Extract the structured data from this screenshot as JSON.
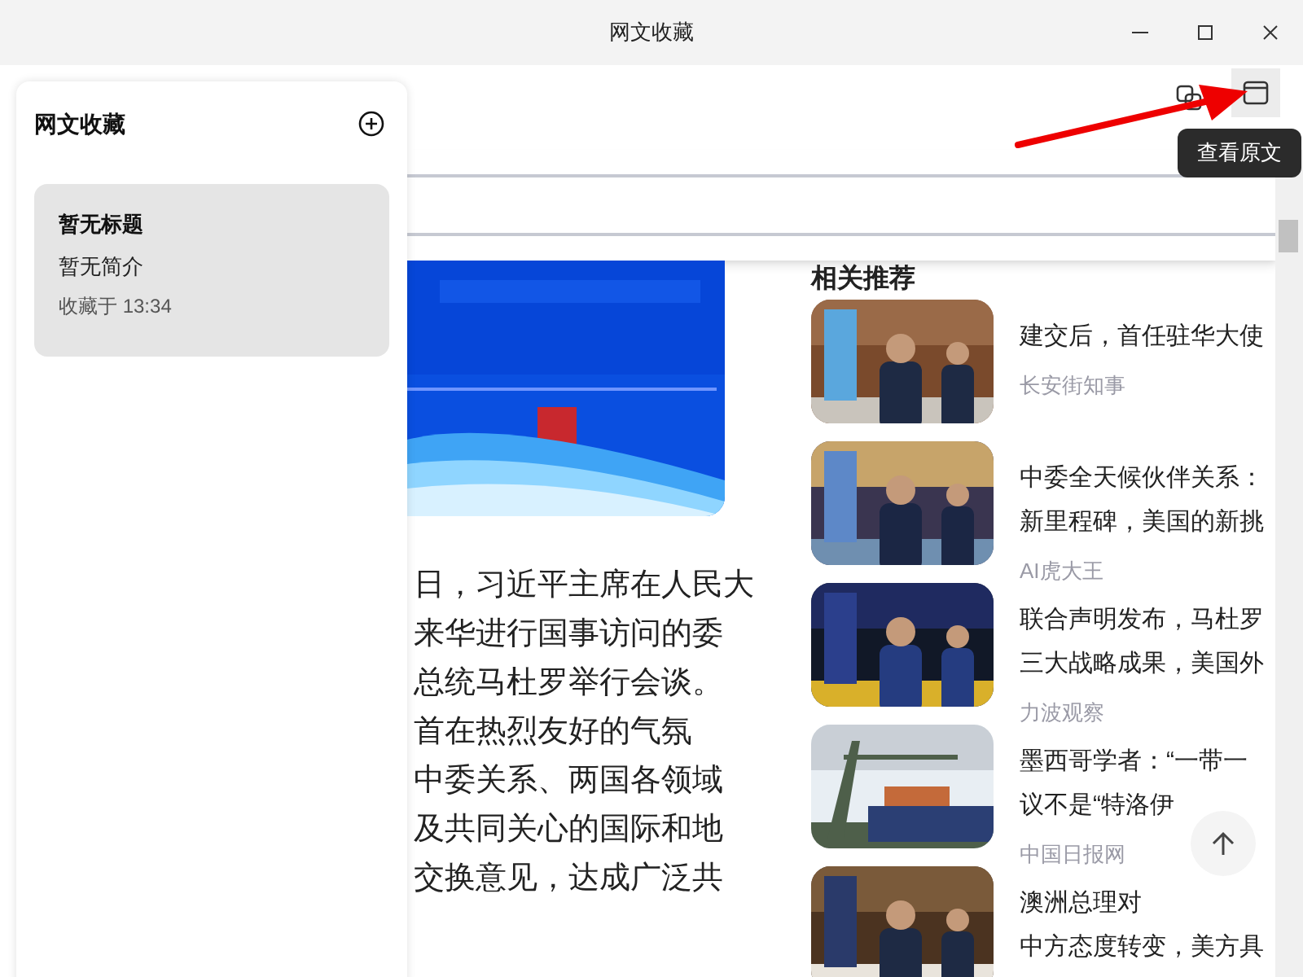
{
  "window": {
    "title": "网文收藏"
  },
  "toolbar": {
    "tooltip": "查看原文"
  },
  "sidebar": {
    "title": "网文收藏",
    "items": [
      {
        "title": "暂无标题",
        "summary": "暂无简介",
        "saved_at": "收藏于 13:34",
        "selected": true
      }
    ]
  },
  "article": {
    "lines": [
      "日，习近平主席在人民大",
      "来华进行国事访问的委",
      "总统马杜罗举行会谈。",
      "首在热烈友好的气氛",
      "中委关系、两国各领域",
      "及共同关心的国际和地",
      "交换意见，达成广泛共"
    ]
  },
  "related": {
    "title": "相关推荐",
    "items": [
      {
        "title_lines": [
          "建交后，首任驻华大使"
        ],
        "source": "长安街知事"
      },
      {
        "title_lines": [
          "中委全天候伙伴关系：",
          "新里程碑，美国的新挑"
        ],
        "source": "AI虎大王"
      },
      {
        "title_lines": [
          "联合声明发布，马杜罗",
          "三大战略成果，美国外"
        ],
        "source": "力波观察"
      },
      {
        "title_lines": [
          "墨西哥学者：“一带一",
          "议不是“特洛伊"
        ],
        "source": "中国日报网"
      },
      {
        "title_lines": [
          "澳洲总理对",
          "中方态度转变，美方具"
        ]
      }
    ]
  }
}
